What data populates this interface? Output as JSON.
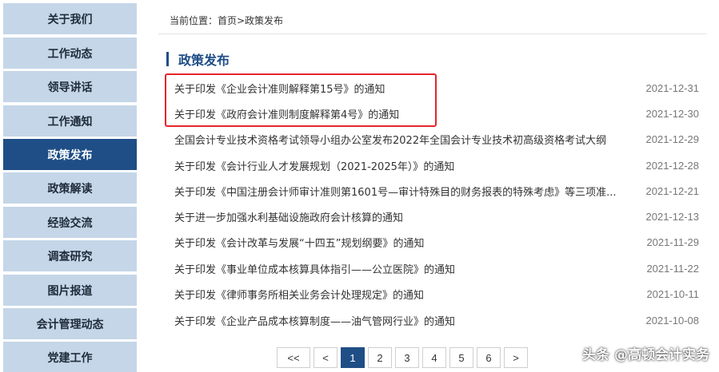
{
  "sidebar": {
    "items": [
      {
        "label": "关于我们",
        "active": false
      },
      {
        "label": "工作动态",
        "active": false
      },
      {
        "label": "领导讲话",
        "active": false
      },
      {
        "label": "工作通知",
        "active": false
      },
      {
        "label": "政策发布",
        "active": true
      },
      {
        "label": "政策解读",
        "active": false
      },
      {
        "label": "经验交流",
        "active": false
      },
      {
        "label": "调查研究",
        "active": false
      },
      {
        "label": "图片报道",
        "active": false
      },
      {
        "label": "会计管理动态",
        "active": false
      },
      {
        "label": "党建工作",
        "active": false
      }
    ]
  },
  "breadcrumb": "当前位置：首页>政策发布",
  "section_title": "政策发布",
  "news": [
    {
      "title": "关于印发《企业会计准则解释第15号》的通知",
      "date": "2021-12-31"
    },
    {
      "title": "关于印发《政府会计准则制度解释第4号》的通知",
      "date": "2021-12-30"
    },
    {
      "title": "全国会计专业技术资格考试领导小组办公室发布2022年全国会计专业技术初高级资格考试大纲",
      "date": "2021-12-29"
    },
    {
      "title": "关于印发《会计行业人才发展规划（2021-2025年）》的通知",
      "date": "2021-12-28"
    },
    {
      "title": "关于印发《中国注册会计师审计准则第1601号—审计特殊目的财务报表的特殊考虑》等三项准...",
      "date": "2021-12-21"
    },
    {
      "title": "关于进一步加强水利基础设施政府会计核算的通知",
      "date": "2021-12-13"
    },
    {
      "title": "关于印发《会计改革与发展“十四五”规划纲要》的通知",
      "date": "2021-11-29"
    },
    {
      "title": "关于印发《事业单位成本核算具体指引——公立医院》的通知",
      "date": "2021-11-22"
    },
    {
      "title": "关于印发《律师事务所相关业务会计处理规定》的通知",
      "date": "2021-10-11"
    },
    {
      "title": "关于印发《企业产品成本核算制度——油气管网行业》的通知",
      "date": "2021-10-08"
    }
  ],
  "pagination": {
    "first": "<<",
    "prev": "<",
    "pages": [
      "1",
      "2",
      "3",
      "4",
      "5",
      "6"
    ],
    "current": "1",
    "next": ">",
    "accent": "#1f4e86"
  },
  "watermark": "头条 @高顿会计实务",
  "colors": {
    "sidebar_bg": "#c5d6e8",
    "sidebar_active": "#1f4e86",
    "highlight_border": "#e4262b"
  }
}
